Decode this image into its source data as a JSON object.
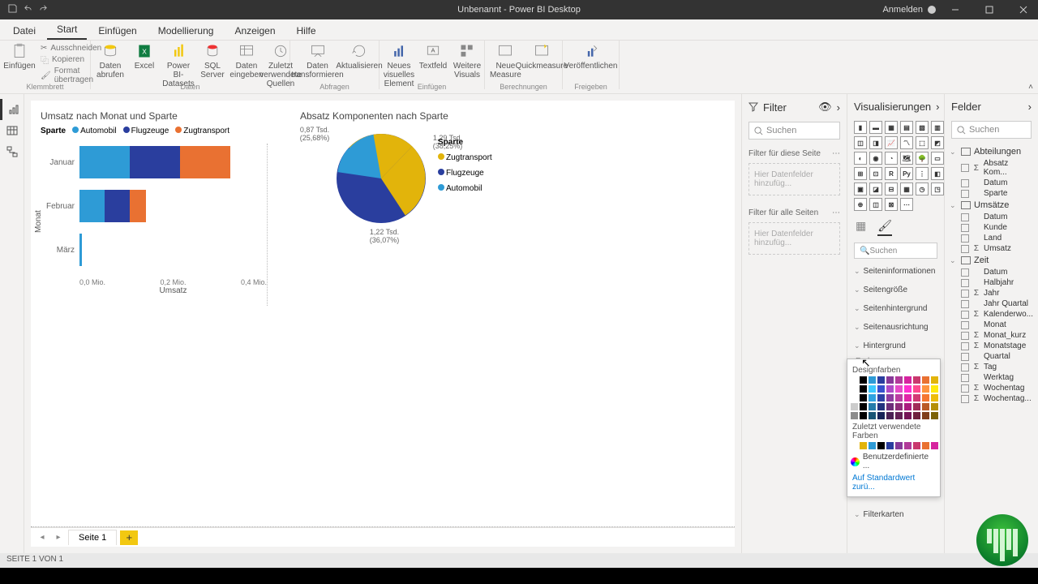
{
  "window": {
    "title": "Unbenannt - Power BI Desktop",
    "login": "Anmelden"
  },
  "menu": {
    "items": [
      "Datei",
      "Start",
      "Einfügen",
      "Modellierung",
      "Anzeigen",
      "Hilfe"
    ],
    "active": 1
  },
  "ribbon": {
    "clipboard": {
      "label": "Klemmbrett",
      "paste": "Einfügen",
      "cut": "Ausschneiden",
      "copy": "Kopieren",
      "format": "Format übertragen"
    },
    "data": {
      "label": "Daten",
      "get": "Daten abrufen",
      "excel": "Excel",
      "pbids": "Power BI-Datasets",
      "sql": "SQL Server",
      "enter": "Daten eingeben",
      "recent": "Zuletzt verwendete Quellen"
    },
    "queries": {
      "label": "Abfragen",
      "transform": "Daten transformieren",
      "refresh": "Aktualisieren"
    },
    "insert": {
      "label": "Einfügen",
      "newvisual": "Neues visuelles Element",
      "textbox": "Textfeld",
      "more": "Weitere Visuals"
    },
    "calc": {
      "label": "Berechnungen",
      "measure": "Neue Measure",
      "quick": "Quickmeasure"
    },
    "share": {
      "label": "Freigeben",
      "publish": "Veröffentlichen"
    }
  },
  "pagebar": {
    "tab": "Seite 1"
  },
  "statusbar": {
    "text": "SEITE 1 VON 1"
  },
  "filter": {
    "title": "Filter",
    "search": "Suchen",
    "thisPage": "Filter für diese Seite",
    "allPages": "Filter für alle Seiten",
    "addHint": "Hier Datenfelder hinzufüg..."
  },
  "viz": {
    "title": "Visualisierungen",
    "search": "Suchen",
    "sections": [
      "Seiteninformationen",
      "Seitengröße",
      "Seitenhintergrund",
      "Seitenausrichtung",
      "Hintergrund",
      "Filterkarten"
    ],
    "colorLabel": "Farbe",
    "icons": [
      "R",
      "Py"
    ]
  },
  "colorpop": {
    "theme": "Designfarben",
    "recent": "Zuletzt verwendete Farben",
    "custom": "Benutzerdefinierte ...",
    "reset": "Auf Standardwert zurü..."
  },
  "fields": {
    "title": "Felder",
    "search": "Suchen",
    "tables": [
      {
        "name": "Abteilungen",
        "items": [
          {
            "n": "Absatz Kom...",
            "s": true
          },
          {
            "n": "Datum"
          },
          {
            "n": "Sparte"
          }
        ]
      },
      {
        "name": "Umsätze",
        "items": [
          {
            "n": "Datum"
          },
          {
            "n": "Kunde"
          },
          {
            "n": "Land"
          },
          {
            "n": "Umsatz",
            "s": true
          }
        ]
      },
      {
        "name": "Zeit",
        "items": [
          {
            "n": "Datum"
          },
          {
            "n": "Halbjahr"
          },
          {
            "n": "Jahr",
            "s": true
          },
          {
            "n": "Jahr Quartal"
          },
          {
            "n": "Kalenderwo...",
            "s": true
          },
          {
            "n": "Monat"
          },
          {
            "n": "Monat_kurz",
            "s": true
          },
          {
            "n": "Monatstage",
            "s": true
          },
          {
            "n": "Quartal"
          },
          {
            "n": "Tag",
            "s": true
          },
          {
            "n": "Werktag"
          },
          {
            "n": "Wochentag",
            "s": true
          },
          {
            "n": "Wochentag...",
            "s": true
          }
        ]
      }
    ]
  },
  "chart_data": [
    {
      "type": "bar",
      "orientation": "h",
      "title": "Umsatz nach Monat und Sparte",
      "stacked": true,
      "legend_title": "Sparte",
      "categories": [
        "Januar",
        "Februar",
        "März"
      ],
      "series": [
        {
          "name": "Automobil",
          "color": "#2E9BD6",
          "values": [
            0.12,
            0.06,
            0.005
          ]
        },
        {
          "name": "Flugzeuge",
          "color": "#2A3E9E",
          "values": [
            0.12,
            0.06,
            0
          ]
        },
        {
          "name": "Zugtransport",
          "color": "#E97132",
          "values": [
            0.12,
            0.04,
            0
          ]
        }
      ],
      "xlabel": "Umsatz",
      "ylabel": "Monat",
      "xticks": [
        "0,0 Mio.",
        "0,2 Mio.",
        "0,4 Mio."
      ],
      "xlim": [
        0,
        0.4
      ]
    },
    {
      "type": "pie",
      "title": "Absatz Komponenten nach Sparte",
      "legend_title": "Sparte",
      "slices": [
        {
          "name": "Zugtransport",
          "value": 867,
          "pct": 25.68,
          "label": "0,87 Tsd.\n(25,68%)",
          "color": "#2E9BD6"
        },
        {
          "name": "Flugzeuge",
          "value": 1290,
          "pct": 38.25,
          "label": "1,29 Tsd.\n(38,25%)",
          "color": "#E2B40B"
        },
        {
          "name": "Automobil",
          "value": 1220,
          "pct": 36.07,
          "label": "1,22 Tsd.\n(36,07%)",
          "color": "#2A3E9E"
        }
      ]
    }
  ],
  "colors": {
    "row": [
      "#ffffff",
      "#000000",
      "#2E9BD6",
      "#2A3E9E",
      "#873a99",
      "#b23a9a",
      "#d6249f",
      "#c9386e",
      "#E97132",
      "#E2B40B"
    ],
    "recent": [
      "#ffffff",
      "#E2B40B",
      "#2E9BD6",
      "#000000",
      "#2A3E9E",
      "#873a99",
      "#b23a9a",
      "#c9386e",
      "#E97132",
      "#d6249f"
    ]
  }
}
